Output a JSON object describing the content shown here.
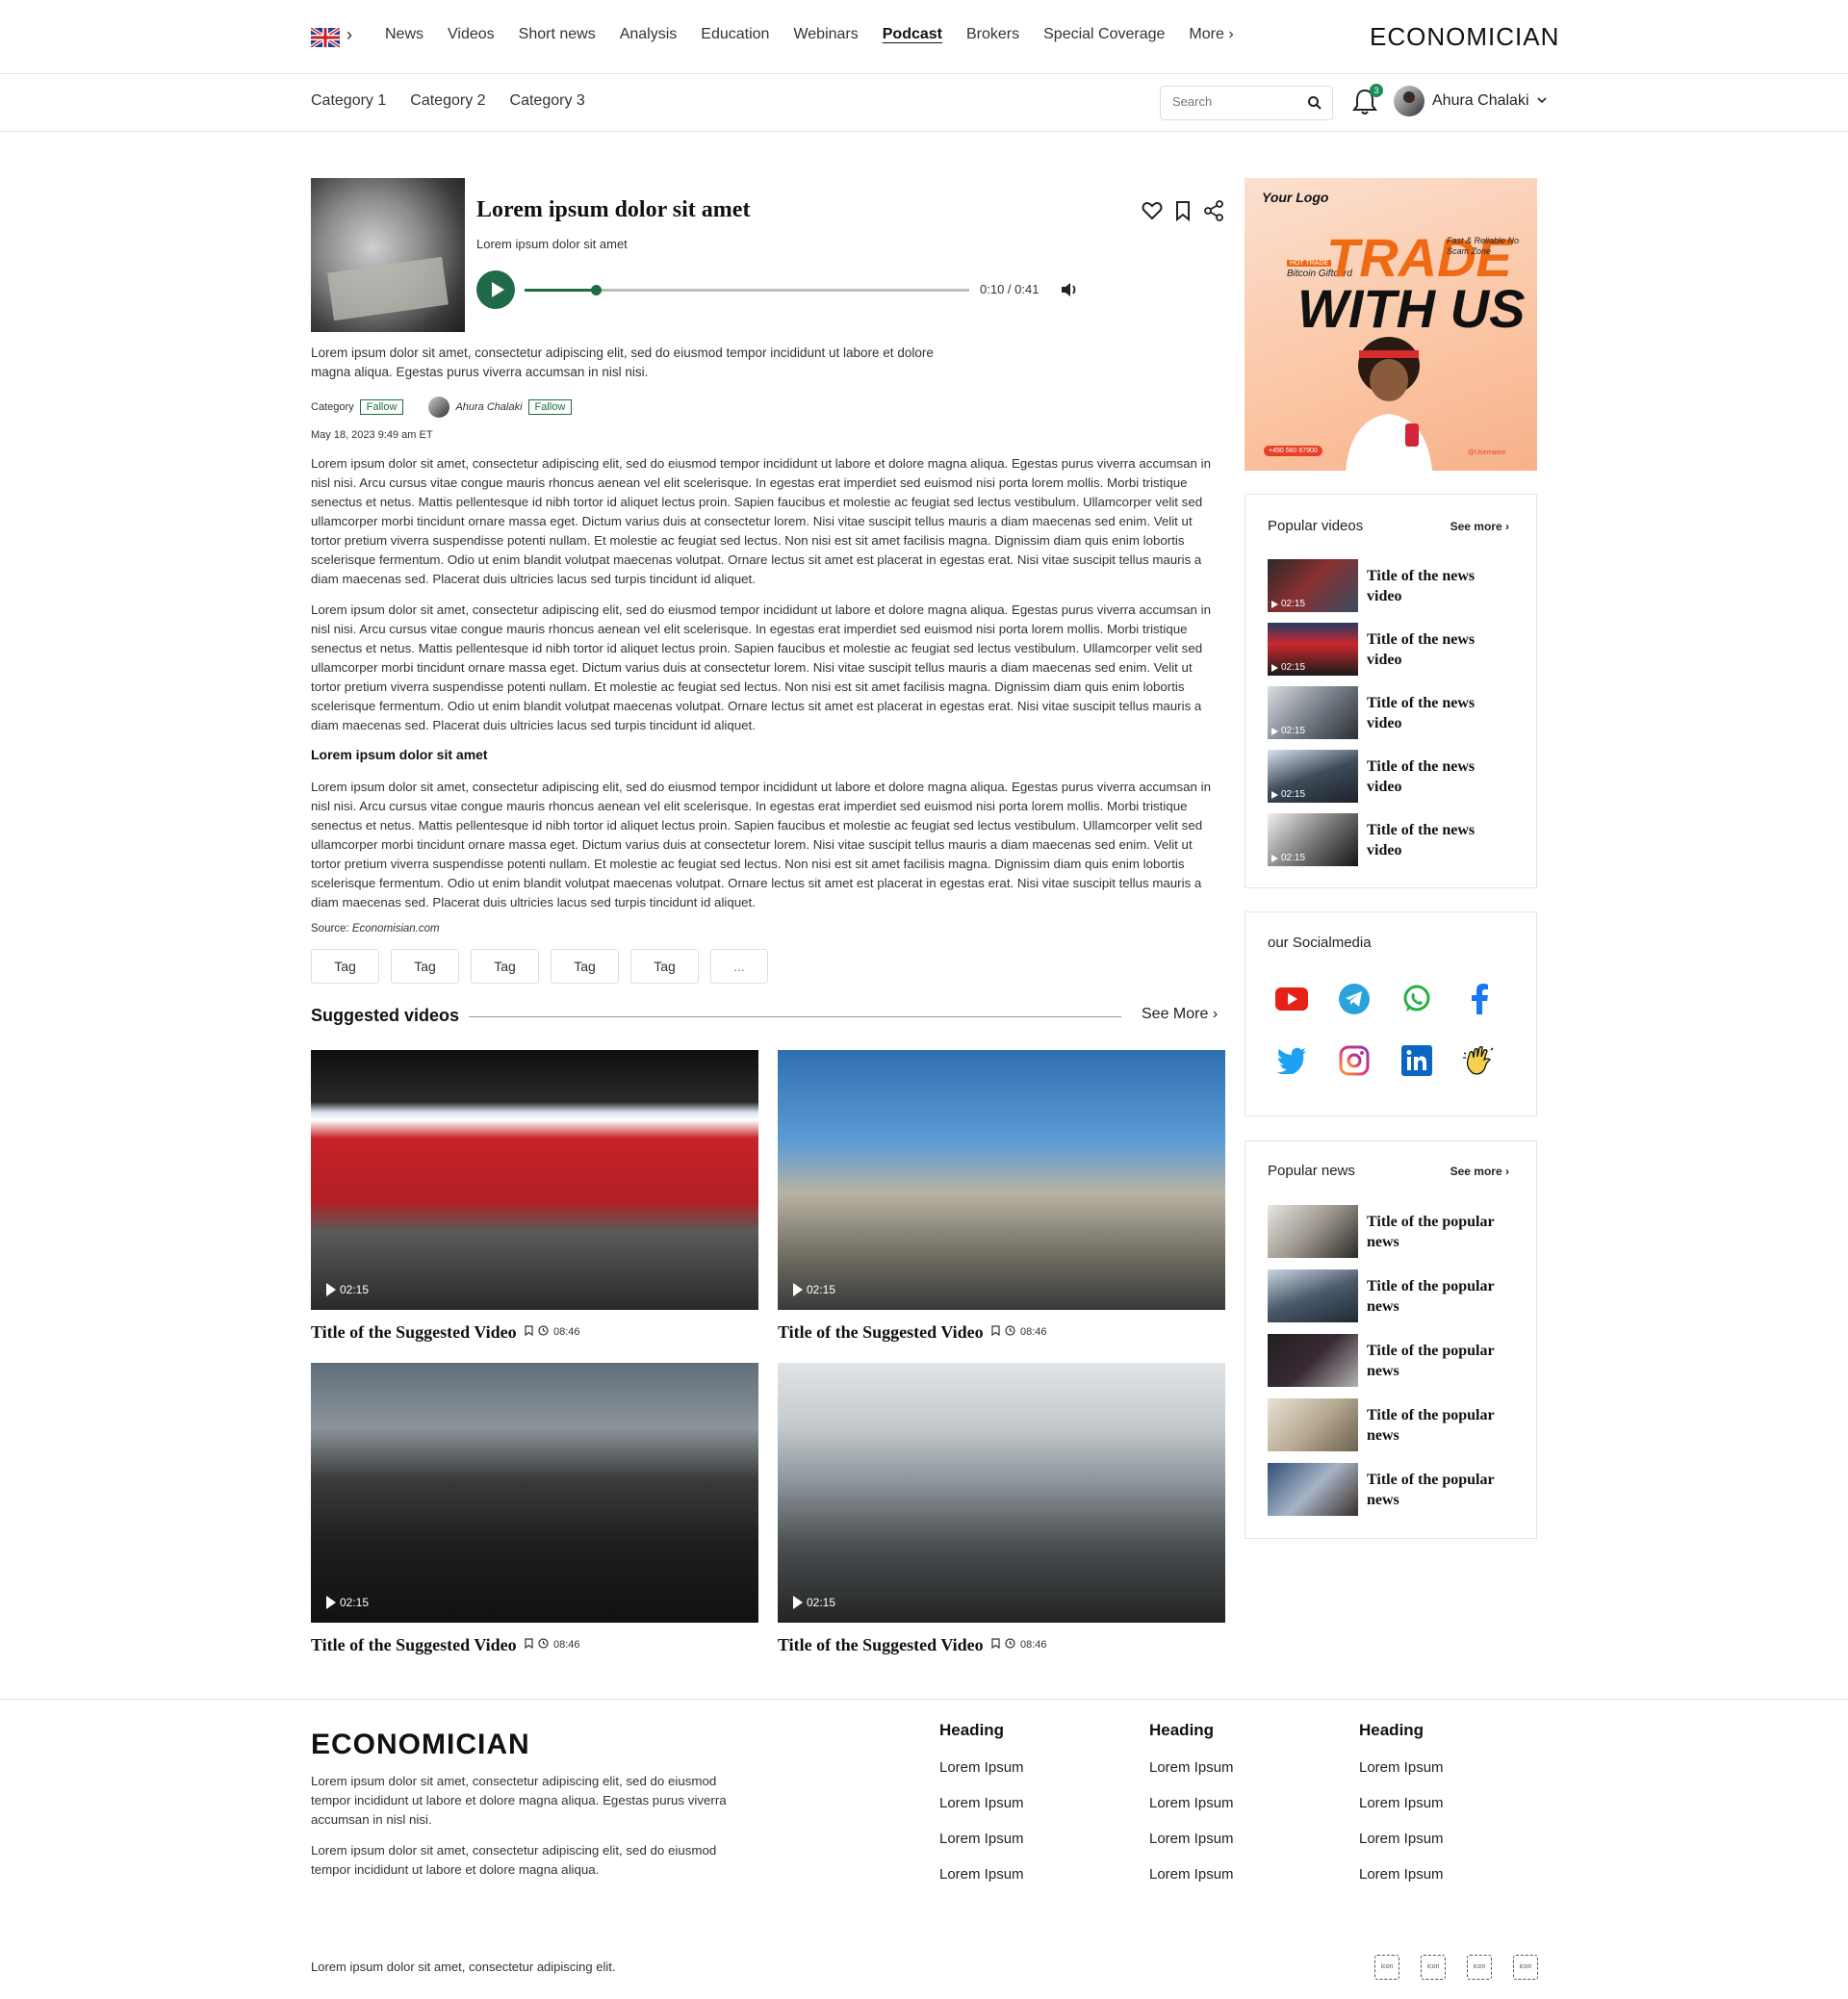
{
  "nav": {
    "items": [
      "News",
      "Videos",
      "Short news",
      "Analysis",
      "Education",
      "Webinars",
      "Podcast",
      "Brokers",
      "Special Coverage",
      "More"
    ],
    "active": "Podcast",
    "brand": "ECONOMICIAN"
  },
  "subnav": {
    "categories": [
      "Category 1",
      "Category 2",
      "Category 3"
    ],
    "search_placeholder": "Search",
    "notification_count": "3",
    "user_name": "Ahura Chalaki"
  },
  "podcast": {
    "title": "Lorem ipsum dolor sit amet",
    "subtitle": "Lorem ipsum dolor sit amet",
    "time": "0:10 / 0:41",
    "progress": 0.16
  },
  "article": {
    "lead": "Lorem ipsum dolor sit amet, consectetur adipiscing elit, sed do eiusmod tempor incididunt ut labore et dolore magna aliqua. Egestas purus viverra accumsan in nisl nisi.",
    "category_label": "Category",
    "follow_label": "Fallow",
    "author": "Ahura Chalaki",
    "date": "May 18, 2023 9:49 am ET",
    "paragraph": "Lorem ipsum dolor sit amet, consectetur adipiscing elit, sed do eiusmod tempor incididunt ut labore et dolore magna aliqua. Egestas purus viverra accumsan in nisl nisi. Arcu cursus vitae congue mauris rhoncus aenean vel elit scelerisque. In egestas erat imperdiet sed euismod nisi porta lorem mollis. Morbi tristique senectus et netus. Mattis pellentesque id nibh tortor id aliquet lectus proin. Sapien faucibus et molestie ac feugiat sed lectus vestibulum. Ullamcorper velit sed ullamcorper morbi tincidunt ornare massa eget. Dictum varius duis at consectetur lorem. Nisi vitae suscipit tellus mauris a diam maecenas sed enim. Velit ut tortor pretium viverra suspendisse potenti nullam. Et molestie ac feugiat sed lectus. Non nisi est sit amet facilisis magna. Dignissim diam quis enim lobortis scelerisque fermentum. Odio ut enim blandit volutpat maecenas volutpat. Ornare lectus sit amet est placerat in egestas erat. Nisi vitae suscipit tellus mauris a diam maecenas sed. Placerat duis ultricies lacus sed turpis tincidunt id aliquet.",
    "subheading": "Lorem ipsum dolor sit amet",
    "source_label": "Source:",
    "source_value": "Economisian.com",
    "tags": [
      "Tag",
      "Tag",
      "Tag",
      "Tag",
      "Tag",
      "..."
    ]
  },
  "suggested": {
    "heading": "Suggested videos",
    "see_more": "See More",
    "videos": [
      {
        "duration": "02:15",
        "title": "Title of the Suggested Video",
        "time": "08:46"
      },
      {
        "duration": "02:15",
        "title": "Title of the Suggested Video",
        "time": "08:46"
      },
      {
        "duration": "02:15",
        "title": "Title of the Suggested Video",
        "time": "08:46"
      },
      {
        "duration": "02:15",
        "title": "Title of the Suggested Video",
        "time": "08:46"
      }
    ]
  },
  "ad": {
    "logo": "Your Logo",
    "headline_1": "TRADE",
    "headline_2": "WITH US",
    "badge": "HOT TRADE",
    "gift": "Bitcoin Giftcard",
    "features": "Fast & Reliable No Scam Zone",
    "phone": "+490 560 67900",
    "username": "@Username"
  },
  "popular_videos": {
    "title": "Popular videos",
    "see_more": "See more",
    "items": [
      {
        "duration": "02:15",
        "title": "Title of the news video"
      },
      {
        "duration": "02:15",
        "title": "Title of the news video"
      },
      {
        "duration": "02:15",
        "title": "Title of the news video"
      },
      {
        "duration": "02:15",
        "title": "Title of the news video"
      },
      {
        "duration": "02:15",
        "title": "Title of the news video"
      }
    ]
  },
  "social": {
    "title": "our Socialmedia",
    "icons": [
      "youtube-icon",
      "telegram-icon",
      "whatsapp-icon",
      "facebook-icon",
      "twitter-icon",
      "instagram-icon",
      "linkedin-icon",
      "clubhouse-icon"
    ]
  },
  "popular_news": {
    "title": "Popular news",
    "see_more": "See more",
    "items": [
      {
        "title": "Title of the popular news"
      },
      {
        "title": "Title of the popular news"
      },
      {
        "title": "Title of the popular news"
      },
      {
        "title": "Title of the popular news"
      },
      {
        "title": "Title of the popular news"
      }
    ]
  },
  "footer": {
    "brand": "ECONOMICIAN",
    "p1": "Lorem ipsum dolor sit amet, consectetur adipiscing elit, sed do eiusmod tempor incididunt ut labore et dolore magna aliqua. Egestas purus viverra accumsan in nisl nisi.",
    "p2": "Lorem ipsum dolor sit amet, consectetur adipiscing elit, sed do eiusmod tempor incididunt ut labore et dolore magna aliqua.",
    "columns": [
      {
        "heading": "Heading",
        "links": [
          "Lorem Ipsum",
          "Lorem Ipsum",
          "Lorem Ipsum",
          "Lorem Ipsum"
        ]
      },
      {
        "heading": "Heading",
        "links": [
          "Lorem Ipsum",
          "Lorem Ipsum",
          "Lorem Ipsum",
          "Lorem Ipsum"
        ]
      },
      {
        "heading": "Heading",
        "links": [
          "Lorem Ipsum",
          "Lorem Ipsum",
          "Lorem Ipsum",
          "Lorem Ipsum"
        ]
      }
    ],
    "bottom": "Lorem ipsum dolor sit amet, consectetur adipiscing elit.",
    "icon_label": "icon"
  },
  "colors": {
    "accent": "#1f6b45",
    "ad_orange": "#f06a14"
  }
}
